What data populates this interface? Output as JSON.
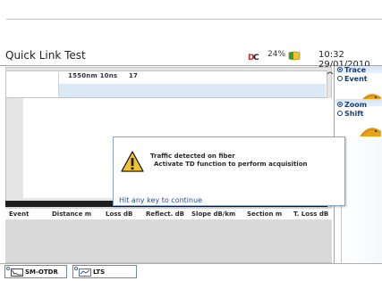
{
  "window": {
    "title": "Quick Link Test",
    "battery_percent": "24%",
    "clock": "10:32 29/01/2010"
  },
  "info_bar": {
    "wavelength": "1550nm",
    "pulse": "10ns",
    "value": "17"
  },
  "right_panel": {
    "group1": {
      "options": [
        "Trace",
        "Event"
      ],
      "selected": "Trace"
    },
    "group2": {
      "options": [
        "Zoom",
        "Shift"
      ],
      "selected": "Zoom"
    }
  },
  "event_table": {
    "columns": [
      "Event",
      "Distance m",
      "Loss dB",
      "Reflect. dB",
      "Slope dB/km",
      "Section m",
      "T. Loss dB"
    ]
  },
  "dialog": {
    "line1": "Traffic detected on fiber",
    "line2": "Activate TD function to perform acquisition",
    "footer": "Hit any key to continue"
  },
  "tabs": [
    {
      "label": "SM-OTDR"
    },
    {
      "label": "LTS"
    }
  ],
  "colors": {
    "accent_blue": "#2c4a8c",
    "info_blue": "#dbe9f7",
    "warning_yellow": "#f2c230",
    "knob_orange": "#e7a31a"
  },
  "icons": [
    "logo-icon",
    "battery-icon",
    "warning-icon",
    "radio-icon",
    "knob-icon",
    "otdr-icon",
    "lts-icon",
    "curl-icon"
  ]
}
